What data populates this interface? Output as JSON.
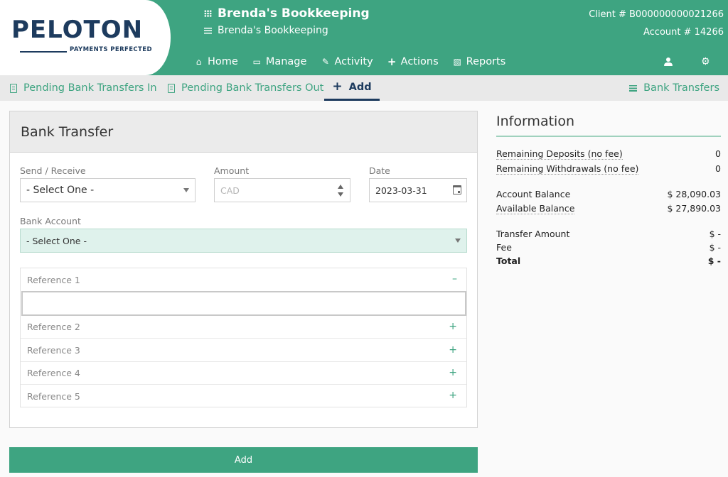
{
  "header": {
    "logo": {
      "text": "PELOTON",
      "tagline": "PAYMENTS PERFECTED"
    },
    "business_title": "Brenda's Bookkeeping",
    "business_subtitle": "Brenda's Bookkeeping",
    "client_label": "Client #",
    "client_number": "B000000000021266",
    "account_label": "Account #",
    "account_number": "14266",
    "nav": [
      {
        "label": "Home",
        "icon": "home-icon"
      },
      {
        "label": "Manage",
        "icon": "monitor-icon"
      },
      {
        "label": "Activity",
        "icon": "document-icon"
      },
      {
        "label": "Actions",
        "icon": "plus-icon"
      },
      {
        "label": "Reports",
        "icon": "clipboard-icon"
      }
    ]
  },
  "subnav": {
    "pending_in": "Pending Bank Transfers In",
    "pending_out": "Pending Bank Transfers Out",
    "add": "Add",
    "bank_transfers": "Bank Transfers"
  },
  "form": {
    "title": "Bank Transfer",
    "send_receive_label": "Send / Receive",
    "send_receive_value": "- Select One -",
    "amount_label": "Amount",
    "amount_placeholder": "CAD",
    "date_label": "Date",
    "date_value": "2023-03-31",
    "bank_account_label": "Bank Account",
    "bank_account_value": "- Select One -",
    "references": [
      {
        "label": "Reference 1",
        "toggle": "–"
      },
      {
        "label": "Reference 2",
        "toggle": "+"
      },
      {
        "label": "Reference 3",
        "toggle": "+"
      },
      {
        "label": "Reference 4",
        "toggle": "+"
      },
      {
        "label": "Reference 5",
        "toggle": "+"
      }
    ],
    "submit_label": "Add"
  },
  "information": {
    "title": "Information",
    "remaining_deposits_label": "Remaining Deposits (no fee)",
    "remaining_deposits_value": "0",
    "remaining_withdrawals_label": "Remaining Withdrawals (no fee)",
    "remaining_withdrawals_value": "0",
    "account_balance_label": "Account Balance",
    "account_balance_value": "$ 28,090.03",
    "available_balance_label": "Available Balance",
    "available_balance_value": "$ 27,890.03",
    "transfer_amount_label": "Transfer Amount",
    "transfer_amount_value": "$ -",
    "fee_label": "Fee",
    "fee_value": "$ -",
    "total_label": "Total",
    "total_value": "$ -"
  },
  "colors": {
    "brand_green": "#3ea481",
    "brand_navy": "#1d3b5e",
    "selected_field_bg": "#dff2ec"
  }
}
